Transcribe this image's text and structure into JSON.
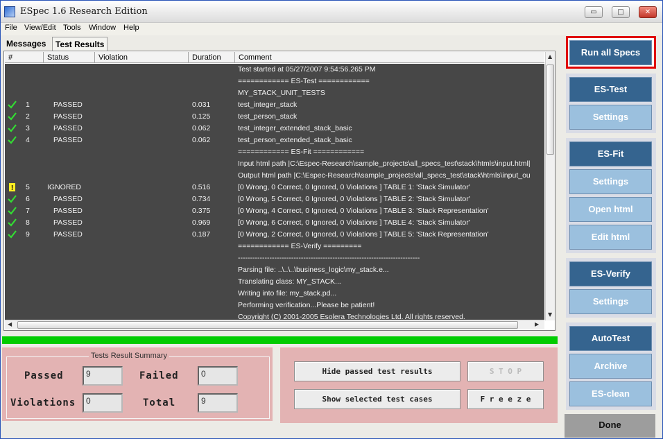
{
  "window": {
    "title": "ESpec 1.6 Research Edition",
    "minimize": "▭",
    "maximize": "□",
    "close": "✕"
  },
  "menu": [
    "File",
    "View/Edit",
    "Tools",
    "Window",
    "Help"
  ],
  "tabs": [
    "Messages",
    "Test Results"
  ],
  "table": {
    "headers": [
      "#",
      "Status",
      "Violation",
      "Duration",
      "Comment"
    ],
    "rows": [
      {
        "icon": "",
        "num": "",
        "status": "",
        "duration": "",
        "comment": "Test started at 05/27/2007 9:54:56.265 PM"
      },
      {
        "icon": "",
        "num": "",
        "status": "",
        "duration": "",
        "comment": "============ ES-Test ============"
      },
      {
        "icon": "",
        "num": "",
        "status": "",
        "duration": "",
        "comment": "MY_STACK_UNIT_TESTS"
      },
      {
        "icon": "check",
        "num": "1",
        "status": "PASSED",
        "duration": "0.031",
        "comment": "test_integer_stack"
      },
      {
        "icon": "check",
        "num": "2",
        "status": "PASSED",
        "duration": "0.125",
        "comment": "test_person_stack"
      },
      {
        "icon": "check",
        "num": "3",
        "status": "PASSED",
        "duration": "0.062",
        "comment": "test_integer_extended_stack_basic"
      },
      {
        "icon": "check",
        "num": "4",
        "status": "PASSED",
        "duration": "0.062",
        "comment": "test_person_extended_stack_basic"
      },
      {
        "icon": "",
        "num": "",
        "status": "",
        "duration": "",
        "comment": "============ ES-Fit ============"
      },
      {
        "icon": "",
        "num": "",
        "status": "",
        "duration": "",
        "comment": "Input html path |C:\\Espec-Research\\sample_projects\\all_specs_test\\stack\\htmls\\input.html|"
      },
      {
        "icon": "",
        "num": "",
        "status": "",
        "duration": "",
        "comment": "Output html path |C:\\Espec-Research\\sample_projects\\all_specs_test\\stack\\htmls\\input_ou"
      },
      {
        "icon": "warn",
        "num": "5",
        "status": "IGNORED",
        "duration": "0.516",
        "comment": " [0 Wrong, 0 Correct, 0 Ignored, 0 Violations ]   TABLE 1: 'Stack Simulator'"
      },
      {
        "icon": "check",
        "num": "6",
        "status": "PASSED",
        "duration": "0.734",
        "comment": "[0 Wrong, 5 Correct, 0 Ignored, 0 Violations ]   TABLE 2: 'Stack Simulator'"
      },
      {
        "icon": "check",
        "num": "7",
        "status": "PASSED",
        "duration": "0.375",
        "comment": "[0 Wrong, 4 Correct, 0 Ignored, 0 Violations ]   TABLE 3: 'Stack Representation'"
      },
      {
        "icon": "check",
        "num": "8",
        "status": "PASSED",
        "duration": "0.969",
        "comment": "[0 Wrong, 6 Correct, 0 Ignored, 0 Violations ]   TABLE 4: 'Stack Simulator'"
      },
      {
        "icon": "check",
        "num": "9",
        "status": "PASSED",
        "duration": "0.187",
        "comment": "[0 Wrong, 2 Correct, 0 Ignored, 0 Violations ]   TABLE 5: 'Stack Representation'"
      },
      {
        "icon": "",
        "num": "",
        "status": "",
        "duration": "",
        "comment": "============ ES-Verify ========="
      },
      {
        "icon": "",
        "num": "",
        "status": "",
        "duration": "",
        "comment": "---------------------------------------------------------------------------"
      },
      {
        "icon": "",
        "num": "",
        "status": "",
        "duration": "",
        "comment": "Parsing file: ..\\..\\..\\business_logic\\my_stack.e..."
      },
      {
        "icon": "",
        "num": "",
        "status": "",
        "duration": "",
        "comment": " Translating class: MY_STACK..."
      },
      {
        "icon": "",
        "num": "",
        "status": "",
        "duration": "",
        "comment": " Writing into file: my_stack.pd..."
      },
      {
        "icon": "",
        "num": "",
        "status": "",
        "duration": "",
        "comment": "Performing verification...Please be patient!"
      },
      {
        "icon": "",
        "num": "",
        "status": "",
        "duration": "",
        "comment": "Copyright (C) 2001-2005 Esolera Technologies Ltd. All rights reserved."
      }
    ]
  },
  "progress": {
    "value": 1.0,
    "color": "#00cc00"
  },
  "summary": {
    "legend": "Tests Result Summary",
    "passed_label": "Passed",
    "passed_value": "9",
    "failed_label": "Failed",
    "failed_value": "0",
    "violations_label": "Violations",
    "violations_value": "0",
    "total_label": "Total",
    "total_value": "9"
  },
  "actions": {
    "hide_passed": "Hide passed test results",
    "stop": "S T O P",
    "show_selected": "Show selected test cases",
    "freeze": "F r e e z e"
  },
  "right_panel": {
    "run_all": "Run all Specs",
    "es_test": "ES-Test",
    "es_test_settings": "Settings",
    "es_fit": "ES-Fit",
    "es_fit_settings": "Settings",
    "open_html": "Open html",
    "edit_html": "Edit html",
    "es_verify": "ES-Verify",
    "es_verify_settings": "Settings",
    "autotest": "AutoTest",
    "archive": "Archive",
    "es_clean": "ES-clean",
    "done": "Done"
  },
  "colors": {
    "accent_dark": "#35648f",
    "accent_light": "#9bc0de",
    "panel_pink": "#e3b3b3",
    "log_bg": "#474747",
    "highlight_red": "#e00000"
  }
}
